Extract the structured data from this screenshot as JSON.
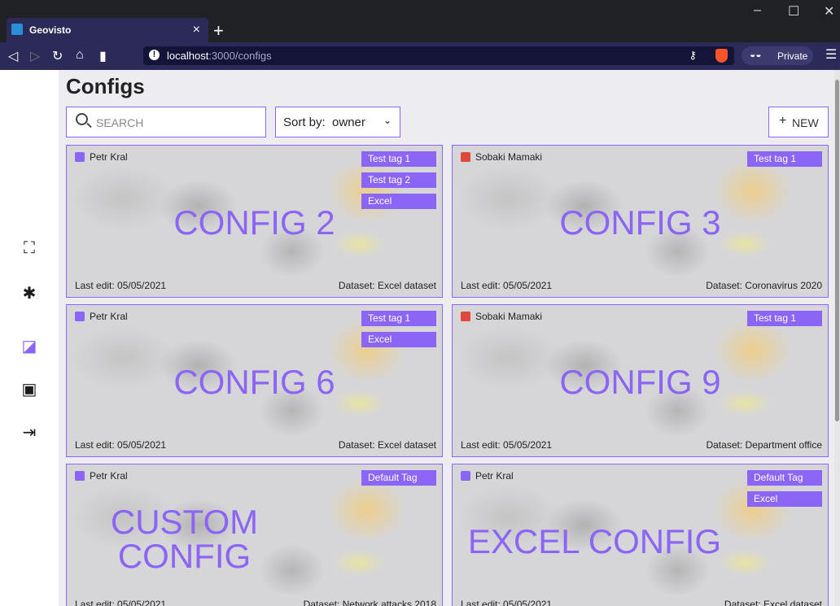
{
  "browser": {
    "tab_title": "Geovisto",
    "tab_close": "×",
    "new_tab": "+",
    "url_host": "localhost",
    "url_path": ":3000/configs",
    "private_label": "Private"
  },
  "colors": {
    "accent": "#8b65f5",
    "tag_bg": "#8b65f5",
    "toolbar": "#2c2a59"
  },
  "sidebar": {
    "items": [
      {
        "icon": "geo-logo-icon",
        "glyph": "⛶"
      },
      {
        "icon": "puzzle-icon",
        "glyph": "✱"
      },
      {
        "icon": "chart-icon",
        "glyph": "◪",
        "active": true
      },
      {
        "icon": "profile-icon",
        "glyph": "▣"
      },
      {
        "icon": "logout-icon",
        "glyph": "⇥"
      }
    ]
  },
  "page": {
    "title": "Configs",
    "search_placeholder": "SEARCH",
    "sort_label": "Sort by:",
    "sort_value": "owner",
    "new_label": "NEW",
    "new_plus": "+"
  },
  "configs": [
    {
      "owner": "Petr Kral",
      "avatar_color": "#8b65f5",
      "tags": [
        "Test tag 1",
        "Test tag 2",
        "Excel"
      ],
      "name_lines": [
        "CONFIG 2"
      ],
      "last_edit": "Last edit: 05/05/2021",
      "dataset": "Dataset: Excel dataset"
    },
    {
      "owner": "Sobaki Mamaki",
      "avatar_color": "#e0483c",
      "tags": [
        "Test tag 1"
      ],
      "name_lines": [
        "CONFIG 3"
      ],
      "last_edit": "Last edit: 05/05/2021",
      "dataset": "Dataset: Coronavirus 2020"
    },
    {
      "owner": "Petr Kral",
      "avatar_color": "#8b65f5",
      "tags": [
        "Test tag 1",
        "Excel"
      ],
      "name_lines": [
        "CONFIG 6"
      ],
      "last_edit": "Last edit: 05/05/2021",
      "dataset": "Dataset: Excel dataset"
    },
    {
      "owner": "Sobaki Mamaki",
      "avatar_color": "#e0483c",
      "tags": [
        "Test tag 1"
      ],
      "name_lines": [
        "CONFIG 9"
      ],
      "last_edit": "Last edit: 05/05/2021",
      "dataset": "Dataset: Department office"
    },
    {
      "owner": "Petr Kral",
      "avatar_color": "#8b65f5",
      "tags": [
        "Default Tag"
      ],
      "name_lines": [
        "CUSTOM",
        "CONFIG"
      ],
      "last_edit": "Last edit: 05/05/2021",
      "dataset": "Dataset: Network attacks 2018"
    },
    {
      "owner": "Petr Kral",
      "avatar_color": "#8b65f5",
      "tags": [
        "Default Tag",
        "Excel"
      ],
      "name_lines": [
        "EXCEL CONFIG"
      ],
      "last_edit": "Last edit: 05/05/2021",
      "dataset": "Dataset: Excel dataset"
    }
  ]
}
